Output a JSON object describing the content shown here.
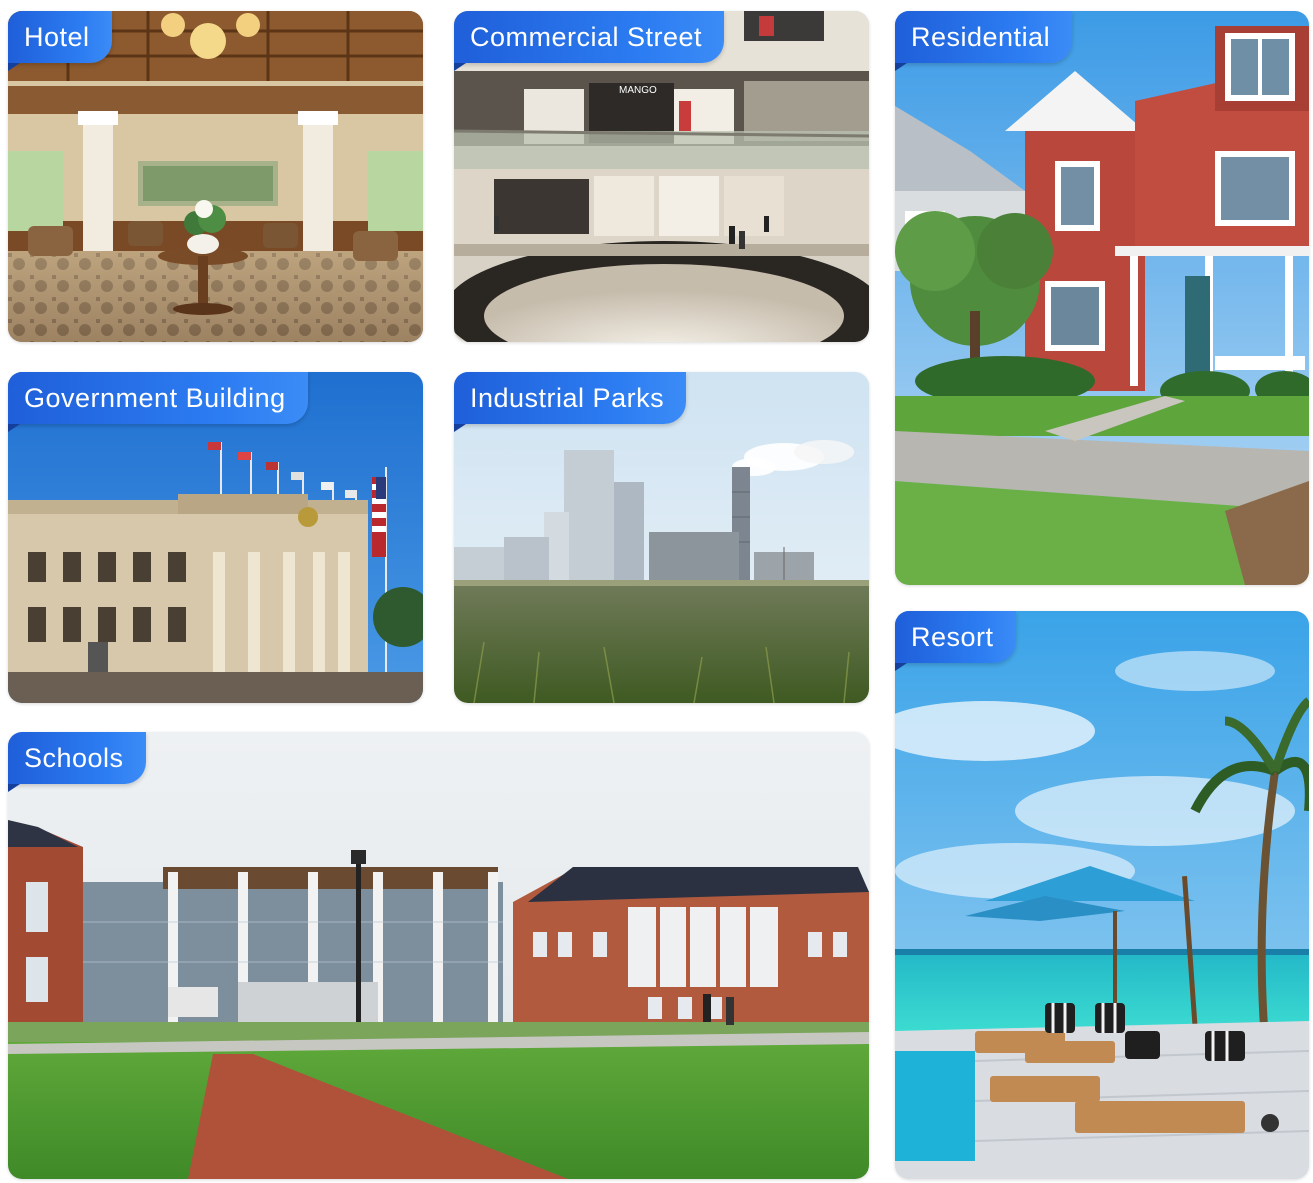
{
  "tiles": {
    "hotel": {
      "label": "Hotel"
    },
    "commercial": {
      "label": "Commercial Street",
      "sign": "MANGO"
    },
    "residential": {
      "label": "Residential"
    },
    "government": {
      "label": "Government Building"
    },
    "industrial": {
      "label": "Industrial Parks"
    },
    "resort": {
      "label": "Resort"
    },
    "schools": {
      "label": "Schools"
    }
  },
  "colors": {
    "tag_start": "#1f5fd9",
    "tag_end": "#3b8cf6",
    "tag_text": "#ffffff"
  }
}
